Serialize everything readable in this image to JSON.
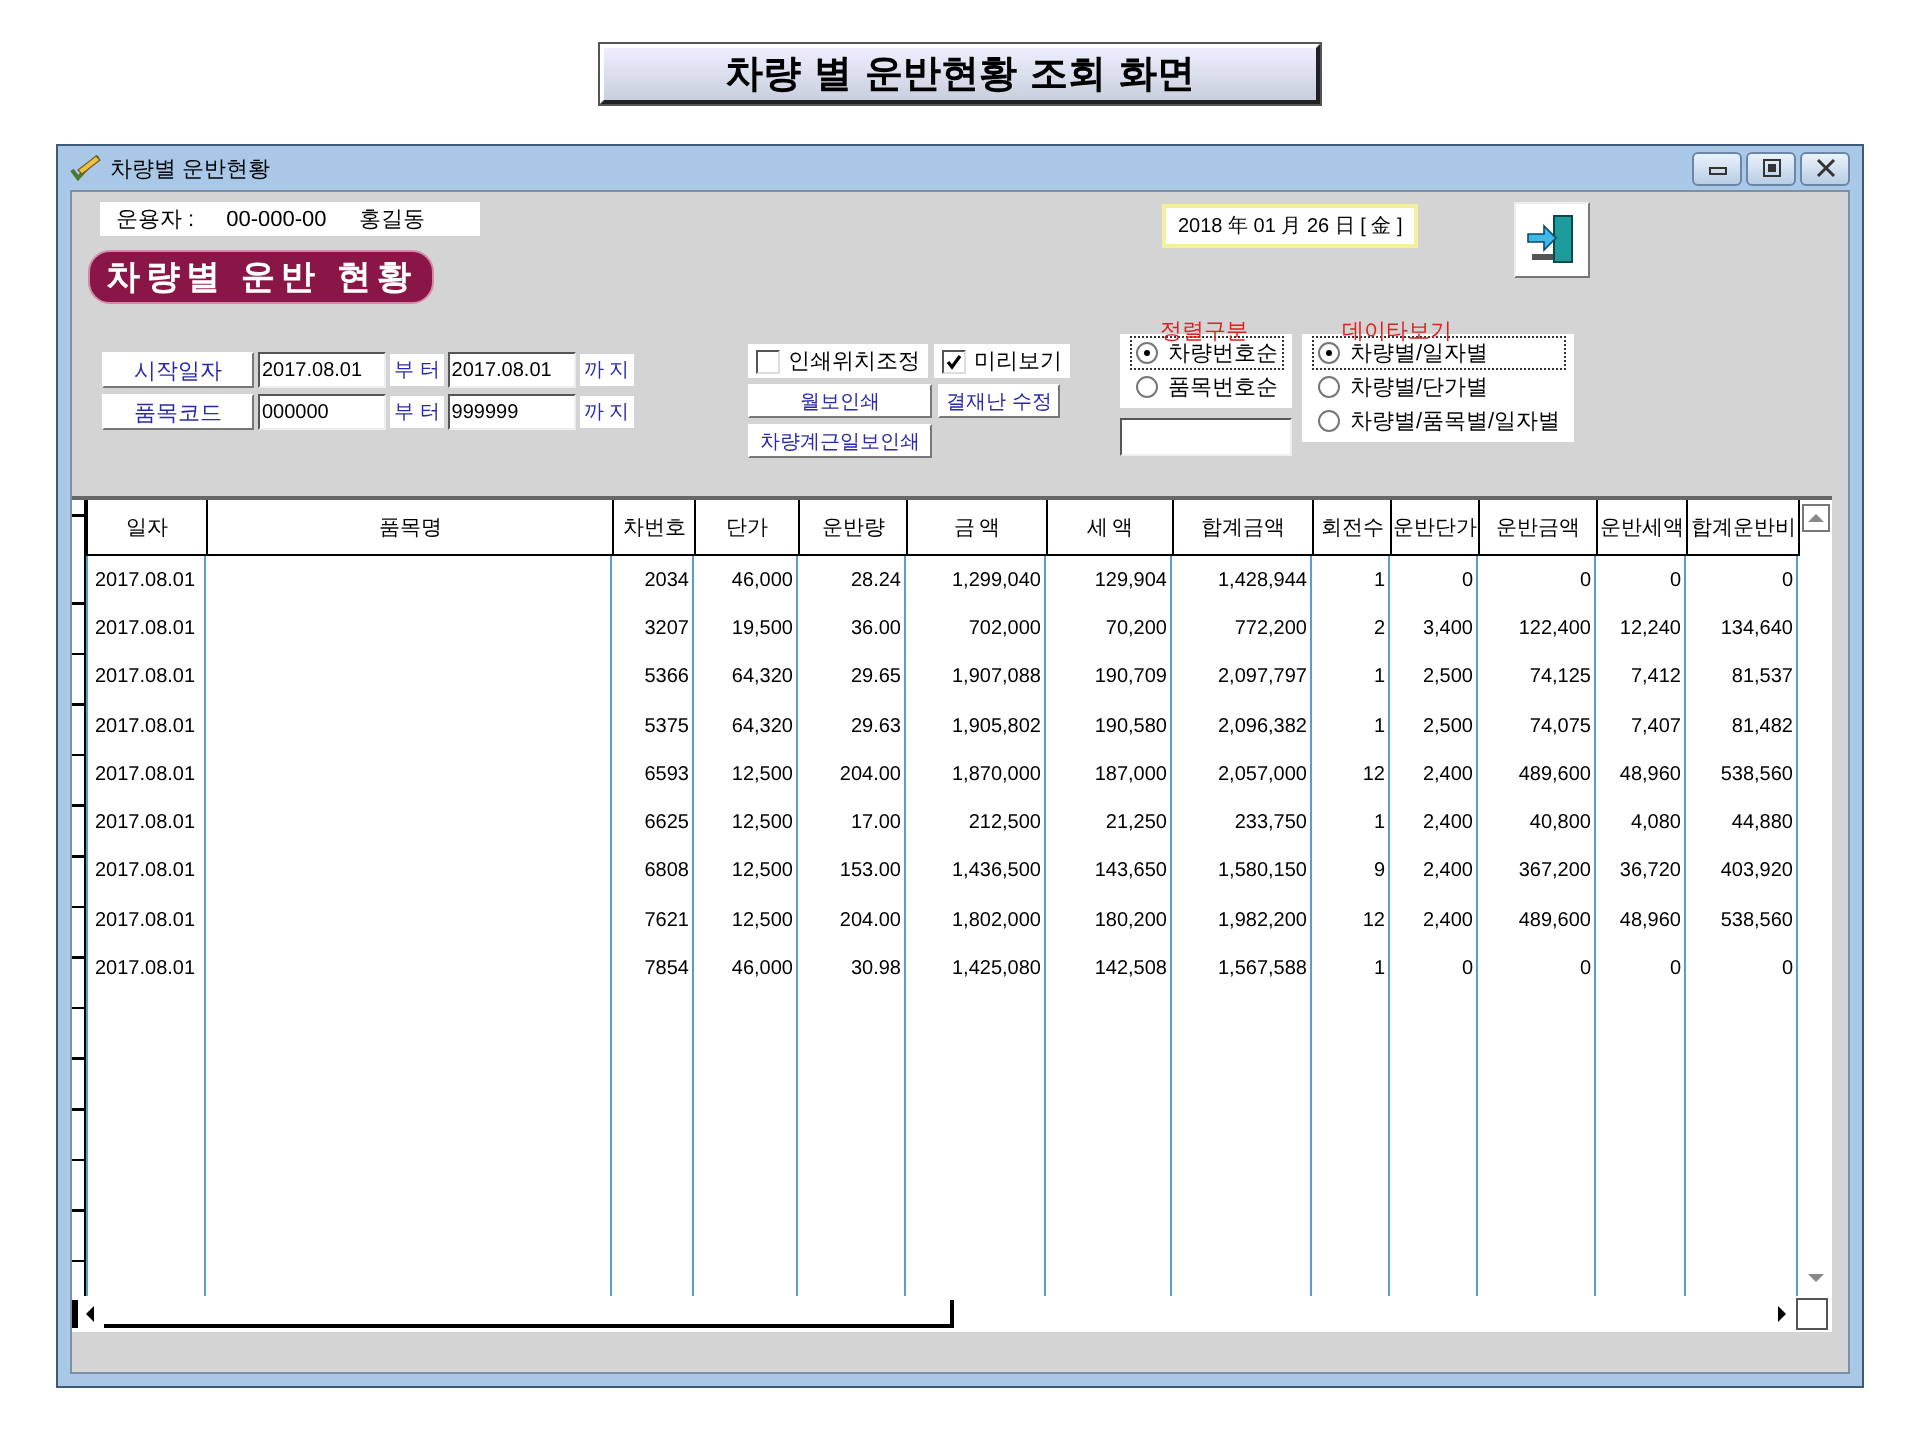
{
  "banner": {
    "title": "차량 별 운반현황 조회 화면"
  },
  "window": {
    "title": "차량별 운반현황"
  },
  "operator": {
    "label": "운용자 :",
    "code": "00-000-00",
    "name": "홍길동"
  },
  "date": "2018 年 01 月 26 日 [ 金 ]",
  "heading": "차량별 운반 현황",
  "filters": [
    {
      "label": "시작일자",
      "from": "2017.08.01",
      "from_suffix": "부 터",
      "to": "2017.08.01",
      "to_suffix": "까 지"
    },
    {
      "label": "품목코드",
      "from": "000000",
      "from_suffix": "부 터",
      "to": "999999",
      "to_suffix": "까 지"
    }
  ],
  "options": [
    {
      "label": "인쇄위치조정",
      "checked": false
    },
    {
      "label": "미리보기",
      "checked": true
    }
  ],
  "buttons": [
    "월보인쇄",
    "결재난 수정",
    "차량계근일보인쇄"
  ],
  "sort_group": {
    "title": "정렬구분",
    "options": [
      {
        "label": "차량번호순",
        "selected": true
      },
      {
        "label": "품목번호순",
        "selected": false
      }
    ]
  },
  "data_view": {
    "title": "데이타보기",
    "options": [
      {
        "label": "차량별/일자별",
        "selected": true
      },
      {
        "label": "차량별/단가별",
        "selected": false
      },
      {
        "label": "차량별/품목별/일자별",
        "selected": false
      }
    ]
  },
  "table": {
    "columns": [
      {
        "label": "일자",
        "kind": "text"
      },
      {
        "label": "품목명",
        "kind": "text"
      },
      {
        "label": "차번호",
        "kind": "number"
      },
      {
        "label": "단가",
        "kind": "number"
      },
      {
        "label": "운반량",
        "kind": "number"
      },
      {
        "label": "금 액",
        "kind": "number"
      },
      {
        "label": "세  액",
        "kind": "number"
      },
      {
        "label": "합계금액",
        "kind": "number"
      },
      {
        "label": "회전수",
        "kind": "number"
      },
      {
        "label": "운반단가",
        "kind": "number"
      },
      {
        "label": "운반금액",
        "kind": "number"
      },
      {
        "label": "운반세액",
        "kind": "number"
      },
      {
        "label": "합계운반비",
        "kind": "number"
      }
    ],
    "rows": [
      [
        "2017.08.01",
        "",
        "2034",
        "46,000",
        "28.24",
        "1,299,040",
        "129,904",
        "1,428,944",
        "1",
        "0",
        "0",
        "0",
        "0"
      ],
      [
        "2017.08.01",
        "",
        "3207",
        "19,500",
        "36.00",
        "702,000",
        "70,200",
        "772,200",
        "2",
        "3,400",
        "122,400",
        "12,240",
        "134,640"
      ],
      [
        "2017.08.01",
        "",
        "5366",
        "64,320",
        "29.65",
        "1,907,088",
        "190,709",
        "2,097,797",
        "1",
        "2,500",
        "74,125",
        "7,412",
        "81,537"
      ],
      [
        "2017.08.01",
        "",
        "5375",
        "64,320",
        "29.63",
        "1,905,802",
        "190,580",
        "2,096,382",
        "1",
        "2,500",
        "74,075",
        "7,407",
        "81,482"
      ],
      [
        "2017.08.01",
        "",
        "6593",
        "12,500",
        "204.00",
        "1,870,000",
        "187,000",
        "2,057,000",
        "12",
        "2,400",
        "489,600",
        "48,960",
        "538,560"
      ],
      [
        "2017.08.01",
        "",
        "6625",
        "12,500",
        "17.00",
        "212,500",
        "21,250",
        "233,750",
        "1",
        "2,400",
        "40,800",
        "4,080",
        "44,880"
      ],
      [
        "2017.08.01",
        "",
        "6808",
        "12,500",
        "153.00",
        "1,436,500",
        "143,650",
        "1,580,150",
        "9",
        "2,400",
        "367,200",
        "36,720",
        "403,920"
      ],
      [
        "2017.08.01",
        "",
        "7621",
        "12,500",
        "204.00",
        "1,802,000",
        "180,200",
        "1,982,200",
        "12",
        "2,400",
        "489,600",
        "48,960",
        "538,560"
      ],
      [
        "2017.08.01",
        "",
        "7854",
        "46,000",
        "30.98",
        "1,425,080",
        "142,508",
        "1,567,588",
        "1",
        "0",
        "0",
        "0",
        "0"
      ]
    ]
  }
}
